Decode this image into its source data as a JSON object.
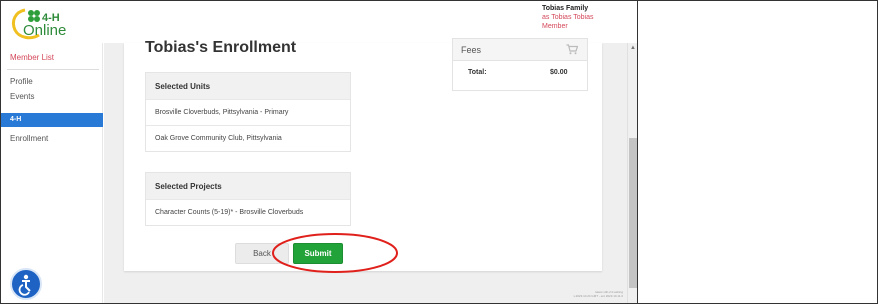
{
  "header": {
    "logo_text": "4-H Online",
    "user": {
      "family": "Tobias Family",
      "as_line": "as Tobias Tobias",
      "role": "Member"
    }
  },
  "sidebar": {
    "member_list": "Member List",
    "items": [
      "Profile",
      "Events"
    ],
    "active_item": "4-H",
    "sub_items": [
      "Enrollment"
    ]
  },
  "enrollment": {
    "title": "Tobias's Enrollment",
    "units": {
      "header": "Selected Units",
      "rows": [
        "Brosville Cloverbuds, Pittsylvania - Primary",
        "Oak Grove Community Club, Pittsylvania"
      ]
    },
    "projects": {
      "header": "Selected Projects",
      "rows": [
        "Character Counts (5-19)* - Brosville Cloverbuds"
      ]
    },
    "fees": {
      "header": "Fees",
      "total_label": "Total:",
      "total_value": "$0.00"
    },
    "back_label": "Back",
    "submit_label": "Submit"
  },
  "footer": {
    "version": "latest v4h-2.0.ashing",
    "build": "v.2023.10.24 GMT - ent 2023.10.11.0"
  },
  "colors": {
    "accent_red": "#d4485a",
    "sidebar_active": "#2979d6",
    "submit_green": "#22a33a",
    "annotation_red": "#e0201b"
  },
  "icons": [
    "cart-icon",
    "chevron-down-icon",
    "accessibility-icon",
    "clover-logo-icon"
  ]
}
